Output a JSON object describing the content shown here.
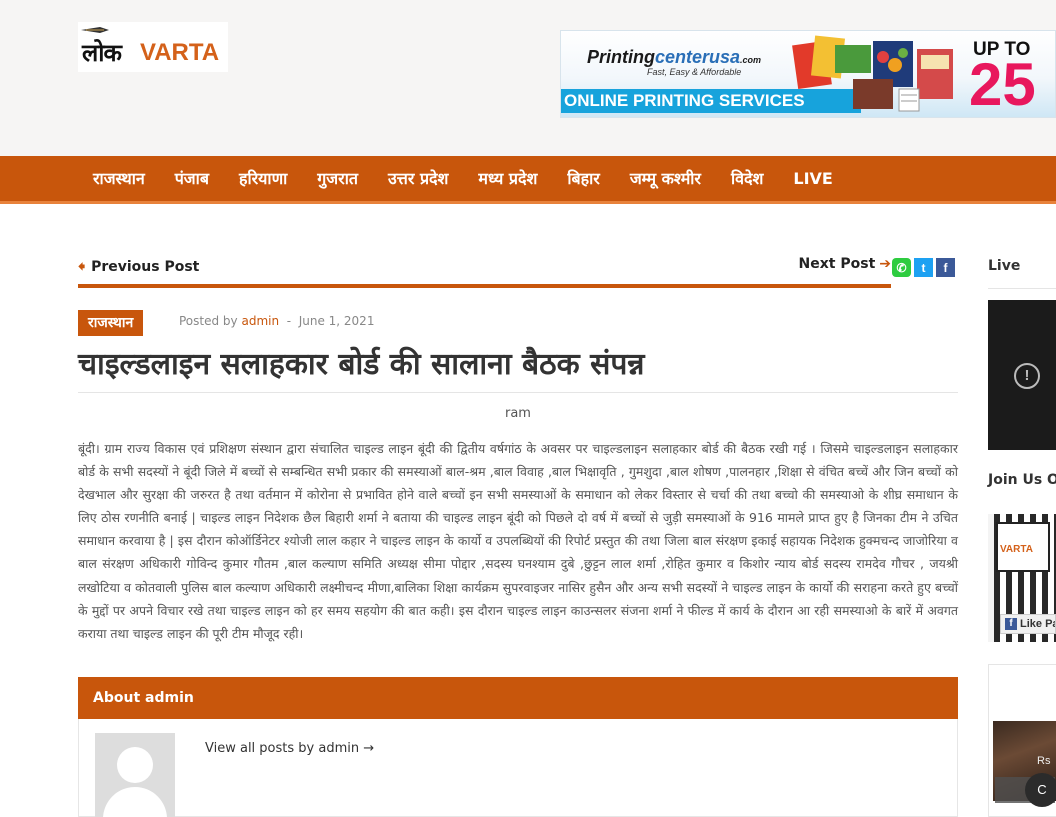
{
  "site": {
    "logo_hindi": "लोक",
    "logo_latin": "VARTA"
  },
  "ad": {
    "brand_main": "Printing",
    "brand_accent": "centerusa",
    "brand_suffix": ".com",
    "tagline": "Fast, Easy & Affordable",
    "services": "ONLINE PRINTING SERVICES",
    "upto": "UP TO",
    "percent": "25"
  },
  "nav": {
    "items": [
      "राजस्थान",
      "पंजाब",
      "हरियाणा",
      "गुजरात",
      "उत्तर प्रदेश",
      "मध्य प्रदेश",
      "बिहार",
      "जम्मू कश्मीर",
      "विदेश",
      "LIVE"
    ]
  },
  "post_nav": {
    "prev_label": "Previous Post",
    "next_label": "Next Post",
    "prev_arrow": "🠸",
    "next_arrow": "➔"
  },
  "share": {
    "whatsapp": "✆",
    "twitter": "t",
    "facebook": "f"
  },
  "post": {
    "category": "राजस्थान",
    "posted_by_prefix": "Posted by",
    "author": "admin",
    "date_sep": "-",
    "date": "June 1, 2021",
    "title": "चाइल्डलाइन सलाहकार बोर्ड की सालाना बैठक संपन्न",
    "byline": "ram",
    "body": "बूंदी। ग्राम राज्य विकास एवं प्रशिक्षण संस्थान द्वारा संचालित चाइल्ड लाइन बूंदी की द्वितीय वर्षगांठ के अवसर पर चाइल्डलाइन सलाहकार बोर्ड की बैठक रखी गई । जिसमे चाइल्डलाइन सलाहकार बोर्ड के सभी सदस्यों ने बूंदी जिले में बच्चों से सम्बन्धित सभी प्रकार की समस्याओं बाल-श्रम ,बाल विवाह ,बाल भिक्षावृति , गुमशुदा ,बाल शोषण ,पालनहार ,शिक्षा से वंचित बच्चें और जिन बच्चों को देखभाल और सुरक्षा की जरुरत है तथा वर्तमान में कोरोना से प्रभावित होने वाले बच्चों इन सभी समस्याओं के समाधान को लेकर विस्तार से चर्चा की तथा बच्चो की समस्याओ के शीघ्र समाधान के लिए ठोस रणनीति बनाई | चाइल्ड लाइन निदेशक छैल बिहारी शर्मा ने बताया की चाइल्ड लाइन बूंदी को पिछले दो वर्ष में बच्चों से जुड़ी समस्याओं के 916 मामले प्राप्त हुए है जिनका टीम ने उचित समाधान करवाया है | इस दौरान कोऑर्डिनेटर श्योजी लाल कहार ने चाइल्ड लाइन के कार्यो व उपलब्धियों की रिपोर्ट प्रस्तुत की तथा जिला बाल संरक्षण इकाई सहायक निदेशक हुक्मचन्द जाजोरिया व बाल संरक्षण अधिकारी गोविन्द कुमार गौतम ,बाल कल्याण समिति अध्यक्ष सीमा पोद्दार ,सदस्य घनश्याम दुबे ,छुट्टन लाल शर्मा ,रोहित कुमार व किशोर न्याय बोर्ड सदस्य रामदेव गौचर , जयश्री लखोटिया व कोतवाली पुलिस बाल कल्याण अधिकारी लक्ष्मीचन्द मीणा,बालिका शिक्षा कार्यक्रम सुपरवाइजर नासिर हुसैन और अन्य सभी सदस्यों ने चाइल्ड लाइन के कार्यो की सराहना करते हुए बच्चों के मुद्दों पर अपने विचार रखे तथा चाइल्ड लाइन को हर समय सहयोग की बात कही। इस दौरान चाइल्ड लाइन काउन्सलर संजना शर्मा ने फील्ड में कार्य के दौरान आ रही समस्याओ के बारें में अवगत कराया तथा चाइल्ड लाइन की पूरी टीम मौजूद रही।"
  },
  "about": {
    "heading": "About admin",
    "view_all": "View all posts by admin →"
  },
  "sidebar": {
    "live_heading": "Live",
    "video_error_icon": "!",
    "join_heading": "Join Us On",
    "fb_page_name": "VARTA",
    "fb_like_icon": "f",
    "fb_like_label": "Like Pa",
    "promo_currency": "Rs",
    "promo_circle": "C"
  },
  "colors": {
    "accent": "#c8560c",
    "nav_border": "#e8823b",
    "logo_orange": "#d4611a"
  }
}
